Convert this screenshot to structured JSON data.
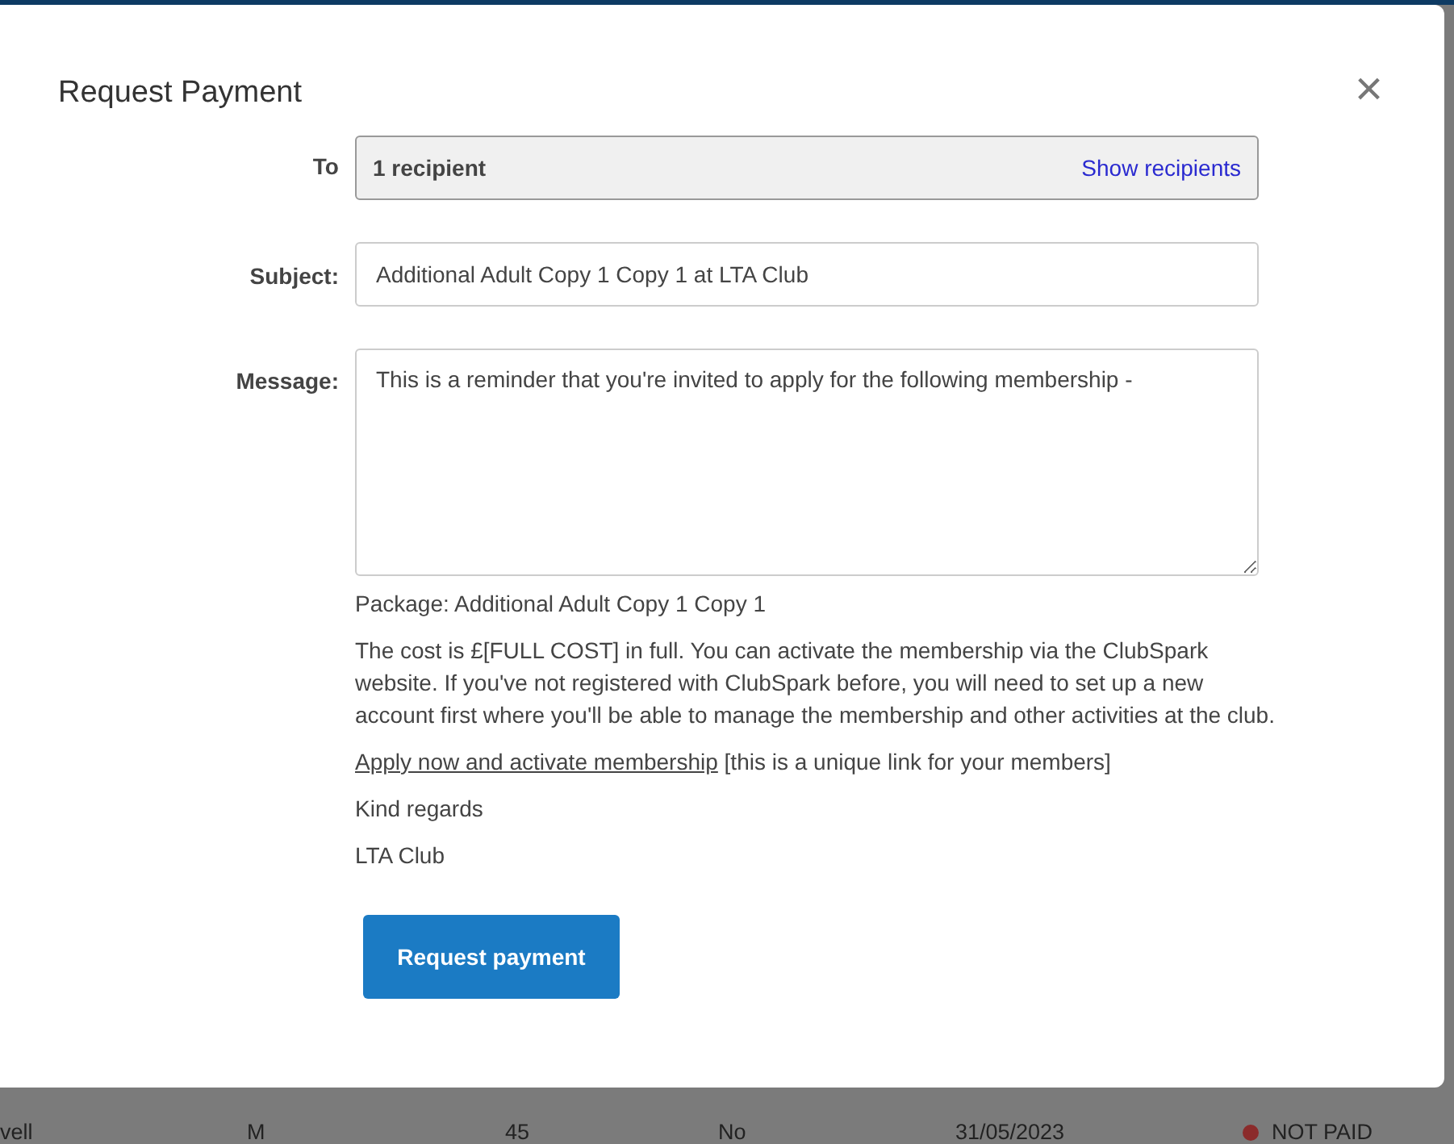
{
  "dialog": {
    "title": "Request Payment",
    "close": "×",
    "to": {
      "label": "To",
      "value": "1 recipient",
      "action": "Show recipients"
    },
    "subject": {
      "label": "Subject:",
      "value": "Additional Adult Copy 1 Copy 1 at LTA Club"
    },
    "message": {
      "label": "Message:",
      "value": "This is a reminder that you're invited to apply for the following membership -"
    },
    "preview": {
      "package": "Package: Additional Adult Copy 1 Copy 1",
      "cost": "The cost is £[FULL COST] in full. You can activate the membership via the ClubSpark website. If you've not registered with ClubSpark before, you will need to set up a new account first where you'll be able to manage the membership and other activities at the club.",
      "link": "Apply now and activate membership",
      "link_note": "[this is a unique link for your members]",
      "closing": "Kind regards",
      "signature": "LTA Club"
    },
    "submit": "Request payment"
  },
  "background_row": {
    "cells": [
      "vell",
      "M",
      "45",
      "No",
      "31/05/2023"
    ],
    "status": {
      "label": "NOT PAID",
      "color": "#8b2b2b"
    }
  }
}
